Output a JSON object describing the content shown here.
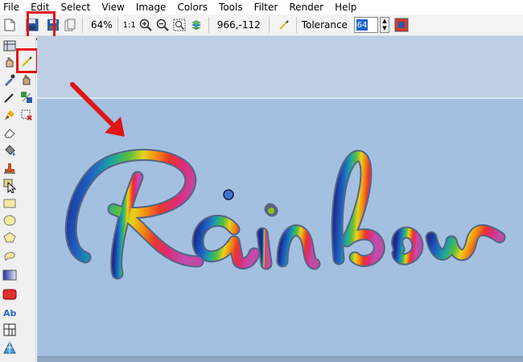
{
  "menu": [
    "File",
    "Edit",
    "Select",
    "View",
    "Image",
    "Colors",
    "Tools",
    "Filter",
    "Render",
    "Help"
  ],
  "toolbar": {
    "zoom": "64%",
    "actual_size": "1:1",
    "coordinates": "966,-112",
    "tolerance_label": "Tolerance",
    "tolerance_value": "64"
  },
  "canvas": {
    "artwork_text": "Rainbow"
  },
  "colors": {
    "highlight": "#e01515",
    "canvas_top": "#bccfe4",
    "canvas_main": "#a3c0e0"
  }
}
